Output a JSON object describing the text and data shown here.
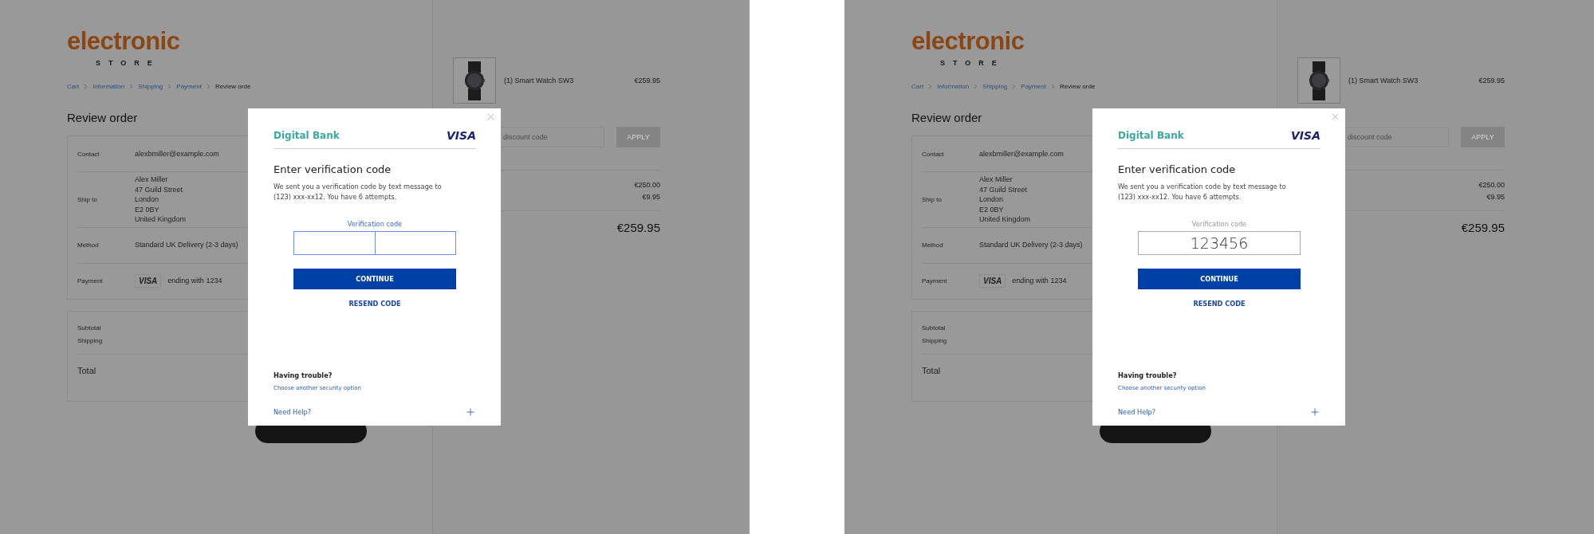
{
  "screens": [
    {
      "store": {
        "logo": "electronic",
        "tagline": "STORE"
      },
      "breadcrumb": [
        {
          "label": "Cart",
          "current": false
        },
        {
          "label": "Information",
          "current": false
        },
        {
          "label": "Shipping",
          "current": false
        },
        {
          "label": "Payment",
          "current": false
        },
        {
          "label": "Review orde",
          "current": true
        }
      ],
      "heading": "Review order",
      "details": [
        {
          "kind": "text",
          "label": "Contact",
          "lines": [
            "alexbmiller@example.com"
          ]
        },
        {
          "kind": "text",
          "label": "Ship to",
          "lines": [
            "Alex Miller",
            "47 Guild Street",
            "London",
            "E2 0BY",
            "United Kingdom"
          ]
        },
        {
          "kind": "text",
          "label": "Method",
          "lines": [
            "Standard UK Delivery (2-3 days)"
          ]
        },
        {
          "kind": "card",
          "label": "Payment",
          "brand": "VISA",
          "lines": [
            "ending with 1234"
          ]
        }
      ],
      "summary_labels": [
        "Subtotal",
        "Shipping"
      ],
      "total_label": "Total",
      "cart": {
        "items": [
          {
            "name": "(1) Smart Watch SW3",
            "price": "€259.95"
          }
        ],
        "discount": {
          "placeholder": "discount code",
          "button": "APPLY"
        },
        "amounts": [
          "€250.00",
          "€9.95"
        ],
        "total": "€259.95"
      },
      "dialog": {
        "bank": "Digital Bank",
        "network": "VISA",
        "title": "Enter verification code",
        "message": "We sent you a verification code by text message to (123) xxx-xx12. You have 6 attempts.",
        "code_field": {
          "label": "Verification code",
          "focused": true
        },
        "continue": "CONTINUE",
        "resend": "RESEND CODE",
        "trouble_title": "Having trouble?",
        "trouble_link": "Choose another security option",
        "help": "Need Help?"
      }
    },
    {
      "store": {
        "logo": "electronic",
        "tagline": "STORE"
      },
      "breadcrumb": [
        {
          "label": "Cart",
          "current": false
        },
        {
          "label": "Information",
          "current": false
        },
        {
          "label": "Shipping",
          "current": false
        },
        {
          "label": "Payment",
          "current": false
        },
        {
          "label": "Review orde",
          "current": true
        }
      ],
      "heading": "Review order",
      "details": [
        {
          "kind": "text",
          "label": "Contact",
          "lines": [
            "alexbmiller@example.com"
          ]
        },
        {
          "kind": "text",
          "label": "Ship to",
          "lines": [
            "Alex Miller",
            "47 Guild Street",
            "London",
            "E2 0BY",
            "United Kingdom"
          ]
        },
        {
          "kind": "text",
          "label": "Method",
          "lines": [
            "Standard UK Delivery (2-3 days)"
          ]
        },
        {
          "kind": "card",
          "label": "Payment",
          "brand": "VISA",
          "lines": [
            "ending with 1234"
          ]
        }
      ],
      "summary_labels": [
        "Subtotal",
        "Shipping"
      ],
      "total_label": "Total",
      "cart": {
        "items": [
          {
            "name": "(1) Smart Watch SW3",
            "price": "€259.95"
          }
        ],
        "discount": {
          "placeholder": "discount code",
          "button": "APPLY"
        },
        "amounts": [
          "€250.00",
          "€9.95"
        ],
        "total": "€259.95"
      },
      "dialog": {
        "bank": "Digital Bank",
        "network": "VISA",
        "title": "Enter verification code",
        "message": "We sent you a verification code by text message to (123) xxx-xx12. You have 6 attempts.",
        "code_field": {
          "label": "Verification code",
          "value": "123456",
          "focused": false
        },
        "continue": "CONTINUE",
        "resend": "RESEND CODE",
        "trouble_title": "Having trouble?",
        "trouble_link": "Choose another security option",
        "help": "Need Help?"
      }
    }
  ]
}
